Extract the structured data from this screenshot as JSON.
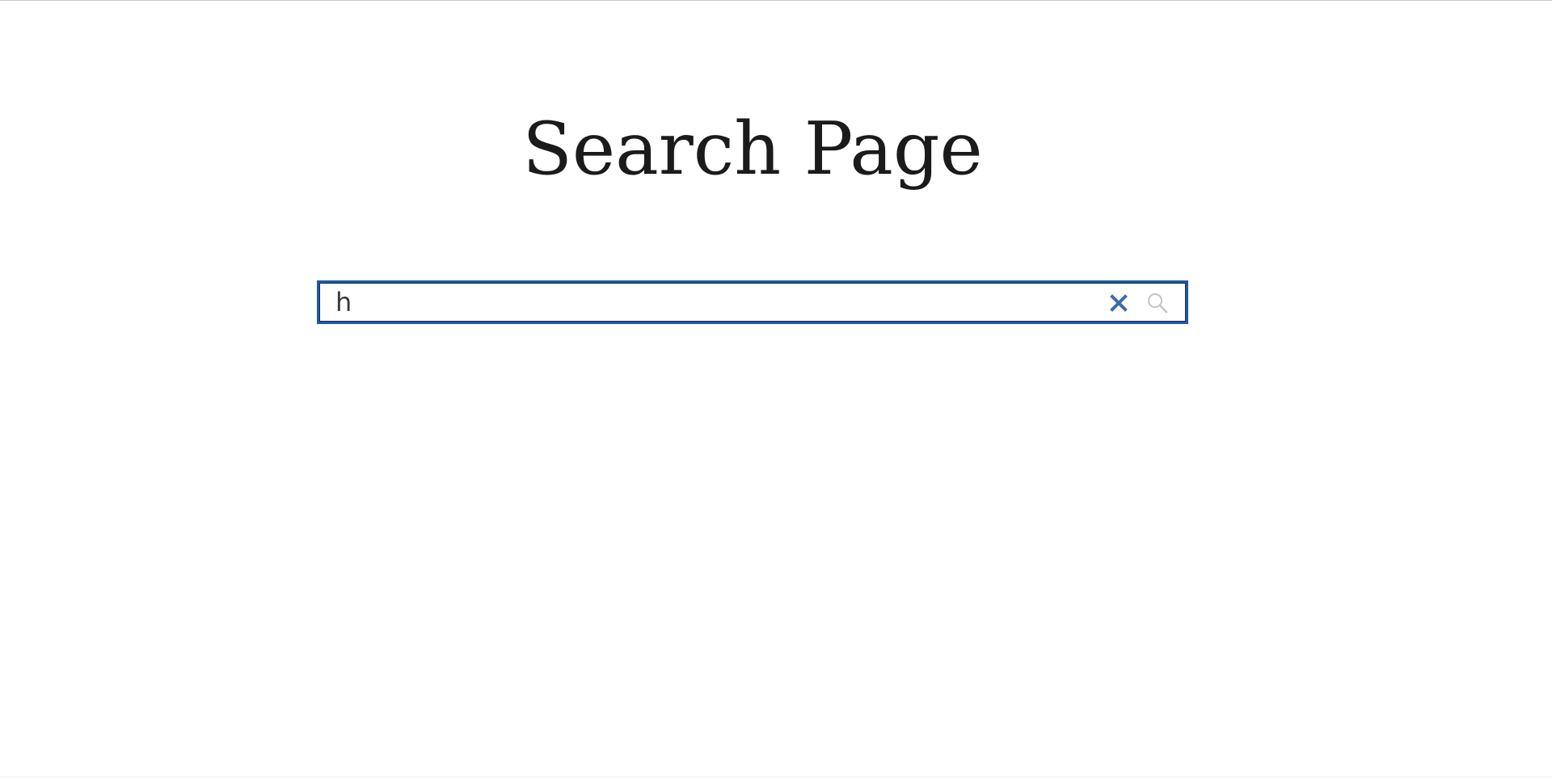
{
  "page": {
    "title": "Search Page"
  },
  "search": {
    "value": "h",
    "placeholder": ""
  },
  "icons": {
    "clear": "close-icon",
    "search": "search-icon"
  },
  "colors": {
    "border": "#1f5aa6",
    "clear_icon": "#3a6ea8",
    "search_icon": "#c4c4c4",
    "title": "#1b1b1b"
  }
}
